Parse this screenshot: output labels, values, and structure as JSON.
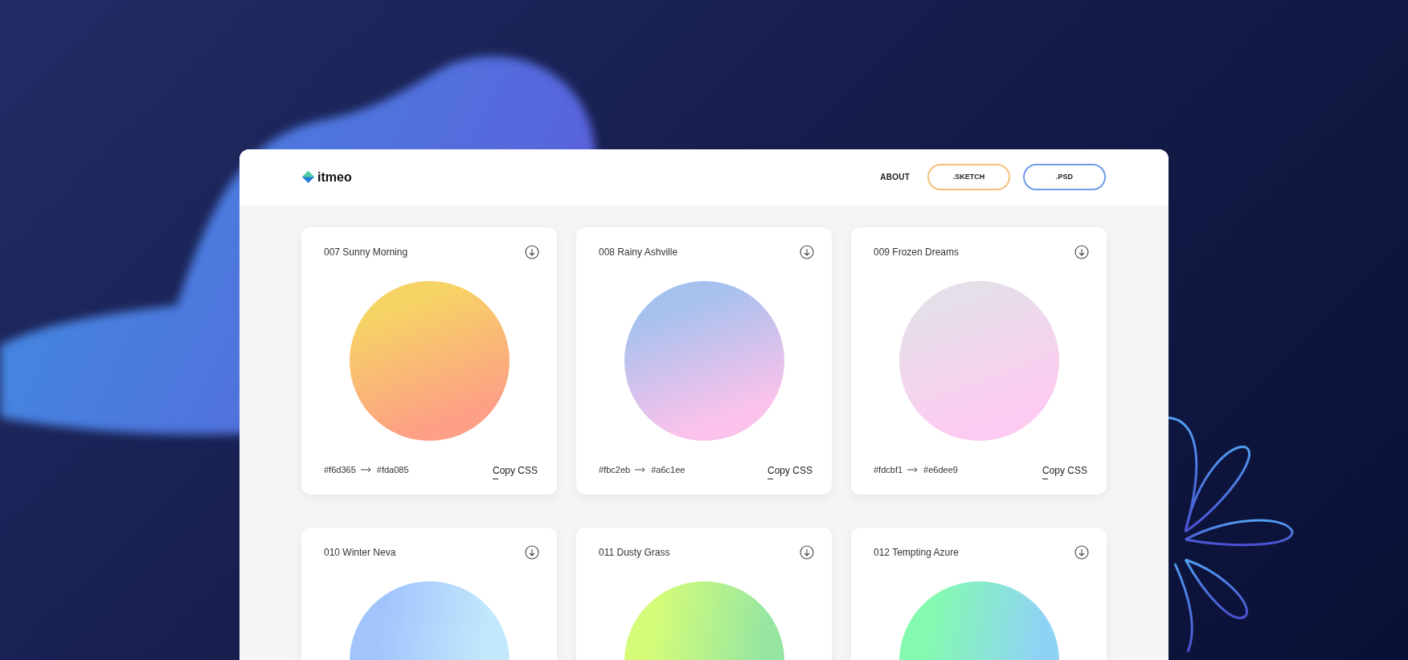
{
  "header": {
    "logo": "itmeo",
    "nav": [
      {
        "label": "ABOUT",
        "kind": "link"
      },
      {
        "label": ".SKETCH",
        "kind": "sketch"
      },
      {
        "label": ".PSD",
        "kind": "psd"
      }
    ]
  },
  "cards": [
    {
      "title": "007 Sunny Morning",
      "from": "#f6d365",
      "to": "#fda085",
      "copy": "Copy CSS",
      "stops": [
        {
          "color": "#f6d365"
        },
        {
          "color": "#fda085"
        }
      ]
    },
    {
      "title": "008 Rainy Ashville",
      "from": "#fbc2eb",
      "to": "#a6c1ee",
      "copy": "Copy CSS",
      "stops": [
        {
          "color": "#a6c1ee"
        },
        {
          "color": "#fbc2eb"
        }
      ]
    },
    {
      "title": "009 Frozen Dreams",
      "from": "#fdcbf1",
      "to": "#e6dee9",
      "copy": "Copy CSS",
      "stops": [
        {
          "color": "#e6dee9"
        },
        {
          "color": "#fdcbf1"
        }
      ]
    },
    {
      "title": "010 Winter Neva",
      "stops": [
        {
          "color": "#a1c4fd"
        },
        {
          "color": "#c2e9fb"
        }
      ]
    },
    {
      "title": "011 Dusty Grass",
      "stops": [
        {
          "color": "#d4fc79"
        },
        {
          "color": "#96e6a1"
        }
      ]
    },
    {
      "title": "012 Tempting Azure",
      "stops": [
        {
          "color": "#84fab0"
        },
        {
          "color": "#8fd3f4"
        }
      ]
    }
  ]
}
